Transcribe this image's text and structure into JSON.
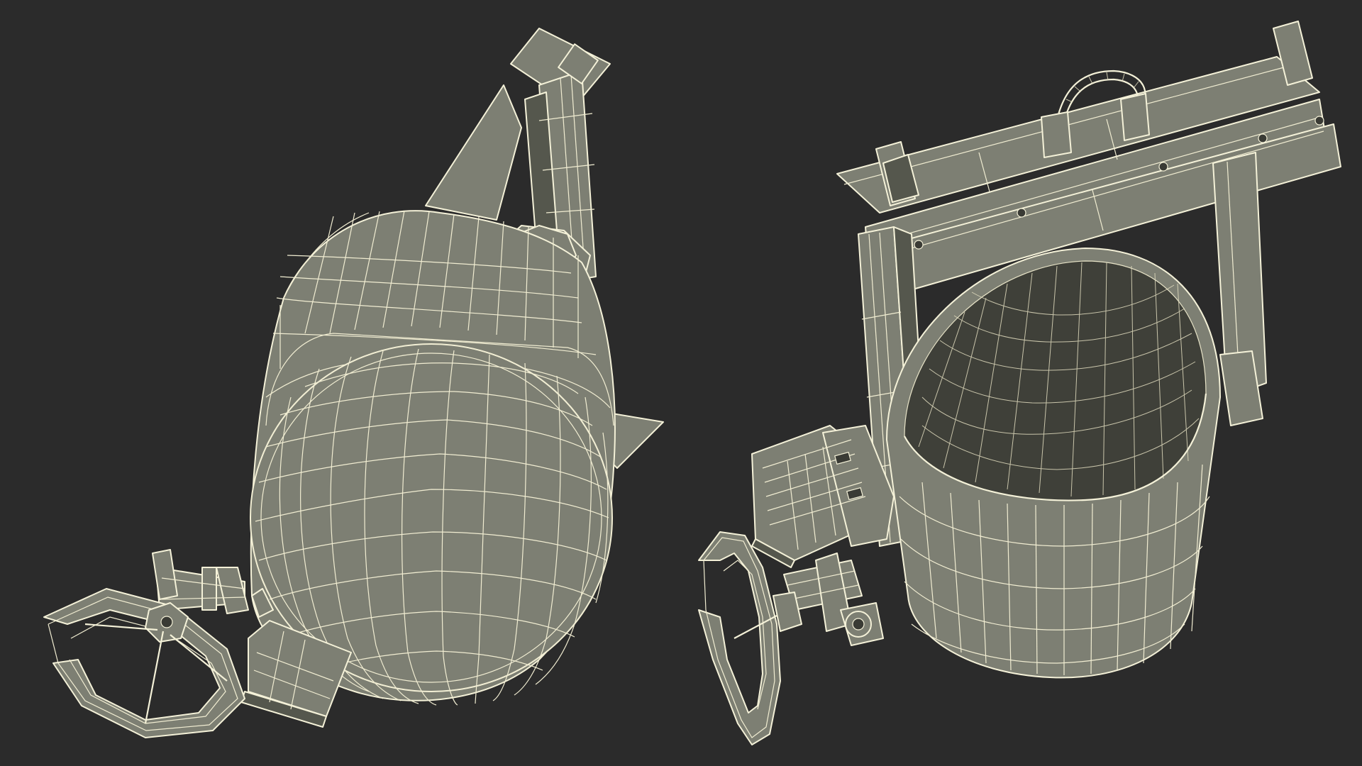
{
  "scene": {
    "background": "#2b2b2b",
    "model_fill": "#7d7f73",
    "wire_color": "#f1edd2",
    "views": [
      {
        "id": "ladle-back-view"
      },
      {
        "id": "ladle-top-view"
      }
    ]
  }
}
